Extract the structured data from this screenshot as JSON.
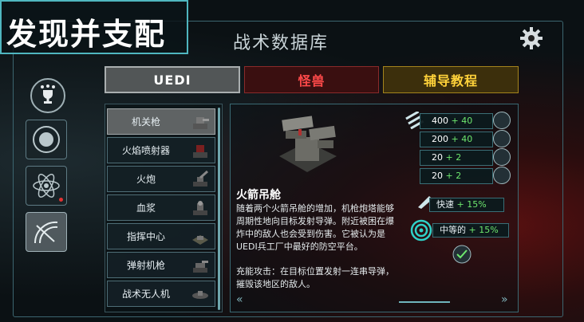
{
  "header": {
    "banner_title": "发现并支配",
    "screen_title": "战术数据库",
    "settings_icon": "gear-icon"
  },
  "sidebar": {
    "items": [
      {
        "icon": "trophy-stars-icon"
      },
      {
        "icon": "orbit-icon"
      },
      {
        "icon": "atom-icon",
        "notification": true
      },
      {
        "icon": "radar-icon",
        "active": true
      }
    ]
  },
  "tabs": [
    {
      "label": "UEDI",
      "color": "#525657",
      "active": true
    },
    {
      "label": "怪兽",
      "color": "#ff4a4a"
    },
    {
      "label": "辅导教程",
      "color": "#ffd23a"
    }
  ],
  "units": [
    {
      "label": "机关枪",
      "selected": true
    },
    {
      "label": "火焰喷射器"
    },
    {
      "label": "火炮"
    },
    {
      "label": "血浆"
    },
    {
      "label": "指挥中心"
    },
    {
      "label": "弹射机枪"
    },
    {
      "label": "战术无人机"
    }
  ],
  "detail": {
    "name": "火箭吊舱",
    "description": "随着两个火箭吊舱的增加，机枪炮塔能够周期性地向目标发射导弹。附近被困在爆炸中的敌人也会受到伤害。它被认为是UEDI兵工厂中最好的防空平台。",
    "ability": "充能攻击：在目标位置发射一连串导弹，摧毁该地区的敌人。",
    "stats": [
      {
        "base": "400",
        "bonus": "+ 40",
        "icon": "damage-icon"
      },
      {
        "base": "200",
        "bonus": "+ 40",
        "icon": "health-icon"
      },
      {
        "base": "20",
        "bonus": "+ 2",
        "icon": "armor-icon"
      },
      {
        "base": "20",
        "bonus": "+ 2",
        "icon": "shield-icon"
      }
    ],
    "speed": {
      "label": "快速",
      "bonus": "+ 15%"
    },
    "range": {
      "label": "中等的",
      "bonus": "+ 15%"
    },
    "accent_color": "#6ee86e"
  }
}
